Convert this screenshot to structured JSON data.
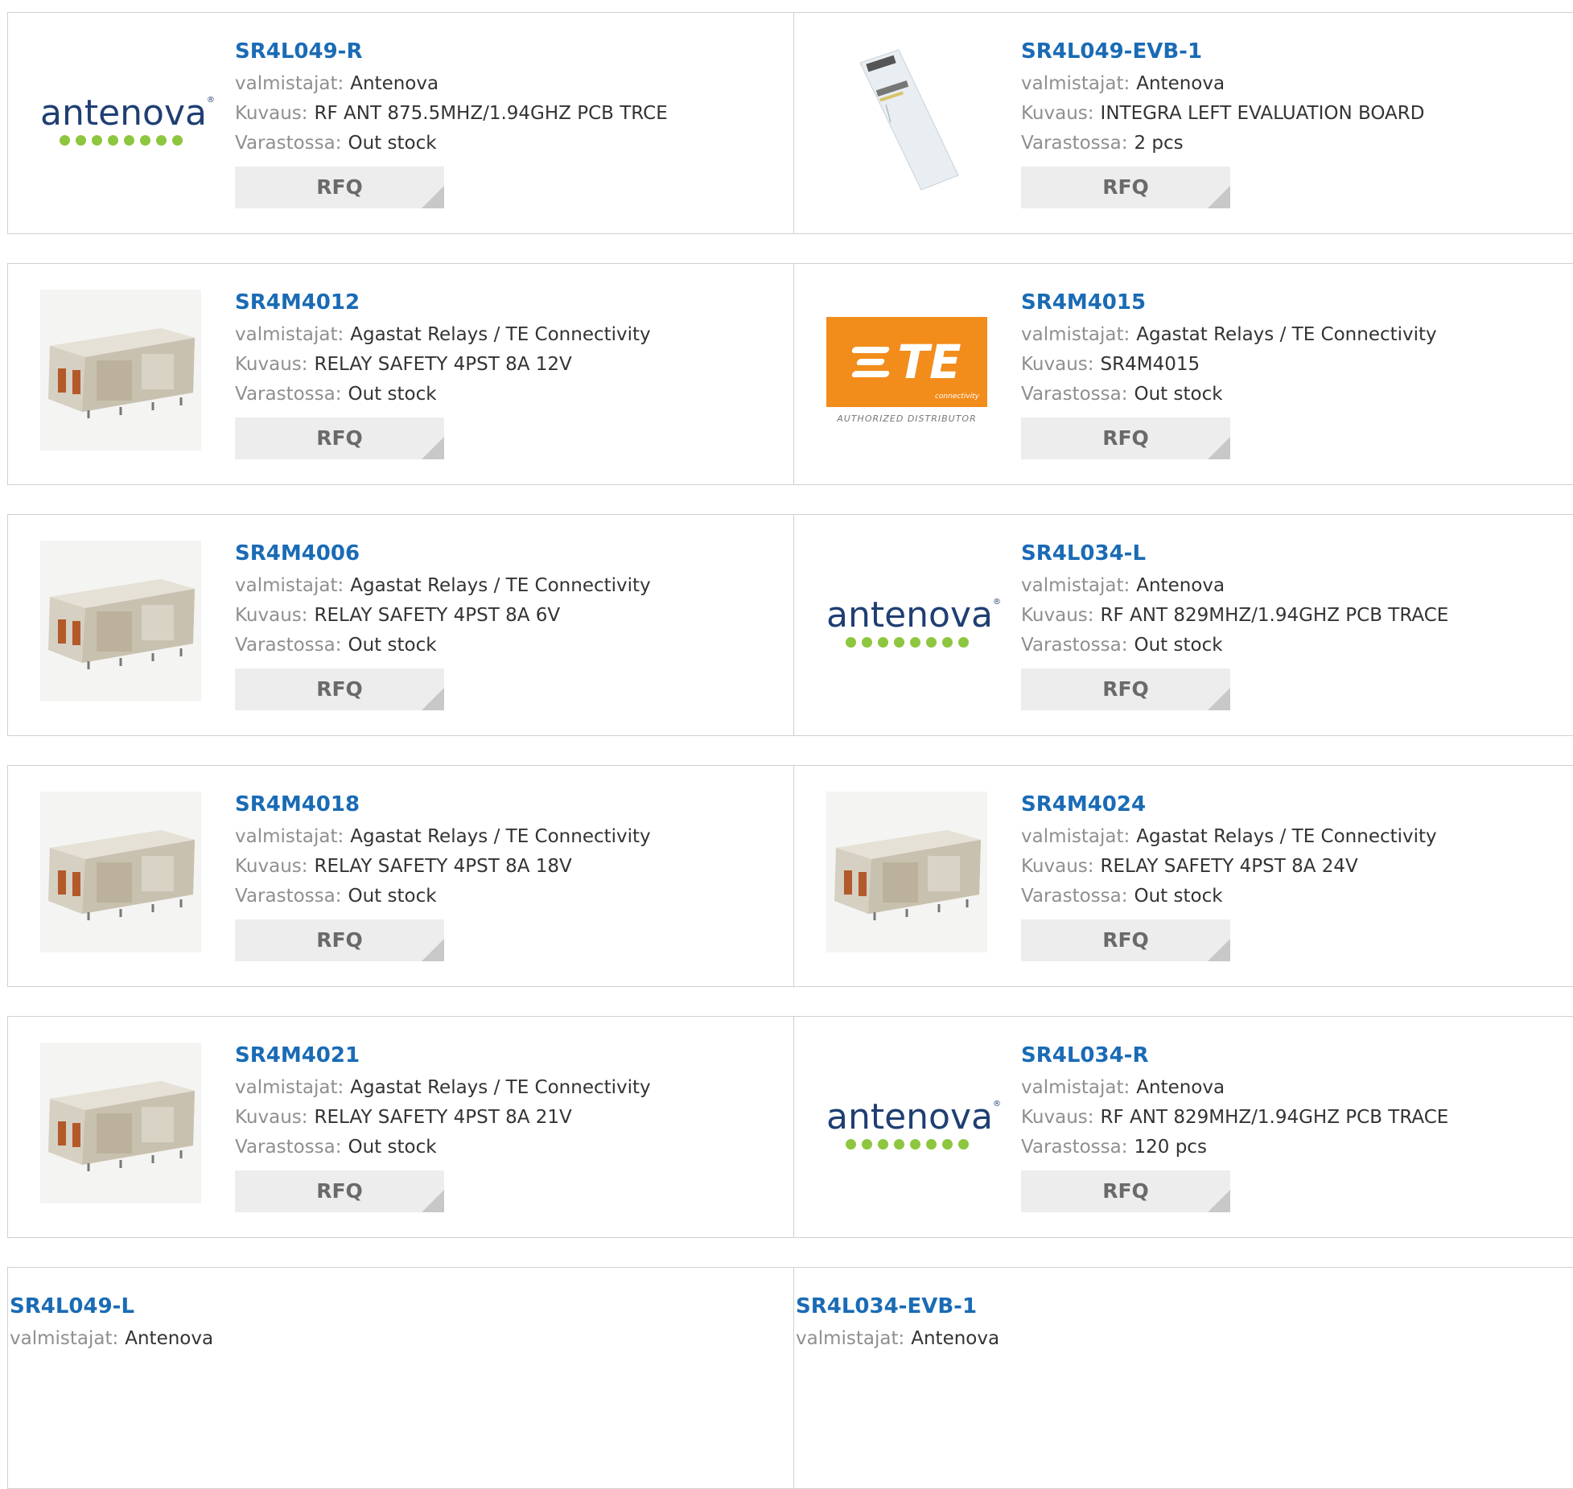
{
  "labels": {
    "manufacturer": "valmistajat:",
    "description": "Kuvaus:",
    "stock": "Varastossa:",
    "rfq": "RFQ"
  },
  "brand_texts": {
    "antenova": "antenova",
    "te_mark": "TE",
    "te_sub": "connectivity",
    "te_authorized": "AUTHORIZED DISTRIBUTOR"
  },
  "colors": {
    "link": "#1a6bb5",
    "antenova_text": "#1f3f73",
    "antenova_dots": "#8dc63f",
    "te_orange": "#f28c1b",
    "rfq_bg": "#ededed"
  },
  "products": [
    {
      "part": "SR4L049-R",
      "manufacturer": "Antenova",
      "description": "RF ANT 875.5MHZ/1.94GHZ PCB TRCE",
      "stock": "Out stock",
      "image": "antenova-logo"
    },
    {
      "part": "SR4L049-EVB-1",
      "manufacturer": "Antenova",
      "description": "INTEGRA LEFT EVALUATION BOARD",
      "stock": "2 pcs",
      "image": "evaluation-board-photo"
    },
    {
      "part": "SR4M4012",
      "manufacturer": "Agastat Relays / TE Connectivity",
      "description": "RELAY SAFETY 4PST 8A 12V",
      "stock": "Out stock",
      "image": "relay-photo"
    },
    {
      "part": "SR4M4015",
      "manufacturer": "Agastat Relays / TE Connectivity",
      "description": "SR4M4015",
      "stock": "Out stock",
      "image": "te-logo"
    },
    {
      "part": "SR4M4006",
      "manufacturer": "Agastat Relays / TE Connectivity",
      "description": "RELAY SAFETY 4PST 8A 6V",
      "stock": "Out stock",
      "image": "relay-photo"
    },
    {
      "part": "SR4L034-L",
      "manufacturer": "Antenova",
      "description": "RF ANT 829MHZ/1.94GHZ PCB TRACE",
      "stock": "Out stock",
      "image": "antenova-logo"
    },
    {
      "part": "SR4M4018",
      "manufacturer": "Agastat Relays / TE Connectivity",
      "description": "RELAY SAFETY 4PST 8A 18V",
      "stock": "Out stock",
      "image": "relay-photo"
    },
    {
      "part": "SR4M4024",
      "manufacturer": "Agastat Relays / TE Connectivity",
      "description": "RELAY SAFETY 4PST 8A 24V",
      "stock": "Out stock",
      "image": "relay-photo"
    },
    {
      "part": "SR4M4021",
      "manufacturer": "Agastat Relays / TE Connectivity",
      "description": "RELAY SAFETY 4PST 8A 21V",
      "stock": "Out stock",
      "image": "relay-photo"
    },
    {
      "part": "SR4L034-R",
      "manufacturer": "Antenova",
      "description": "RF ANT 829MHZ/1.94GHZ PCB TRACE",
      "stock": "120 pcs",
      "image": "antenova-logo"
    },
    {
      "part": "SR4L049-L",
      "manufacturer": "Antenova",
      "image": "none"
    },
    {
      "part": "SR4L034-EVB-1",
      "manufacturer": "Antenova",
      "image": "none"
    }
  ]
}
